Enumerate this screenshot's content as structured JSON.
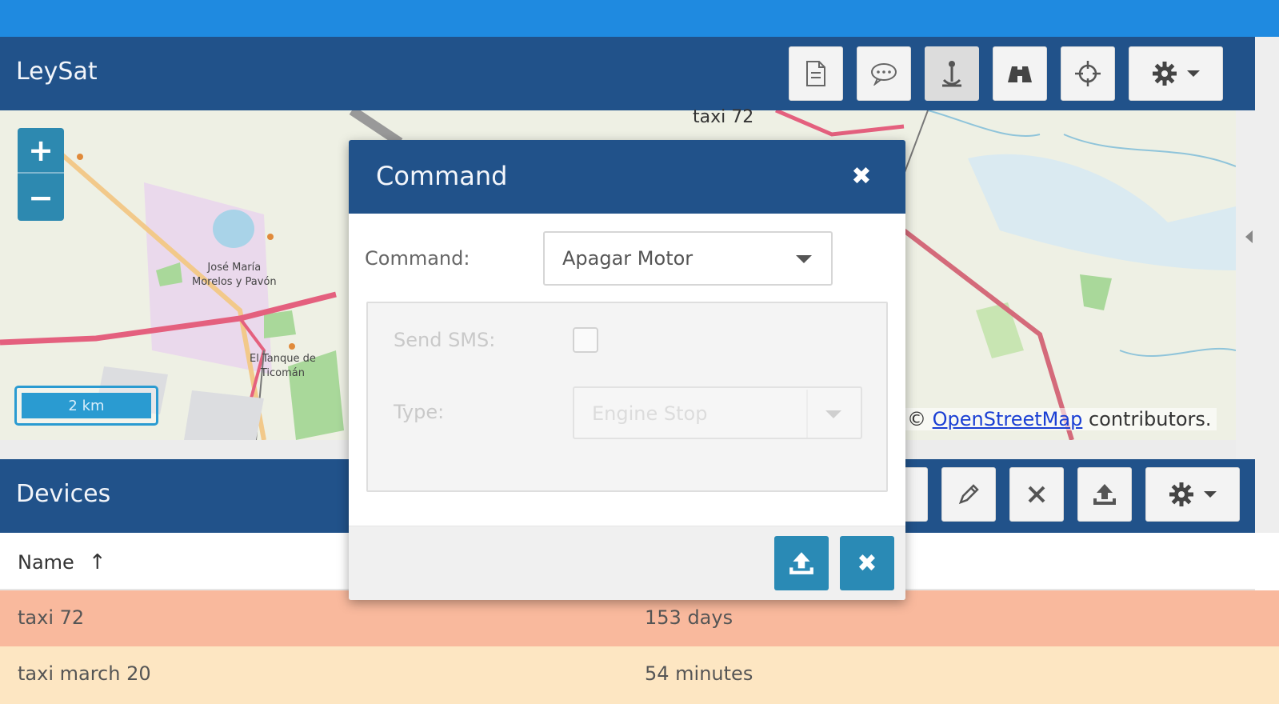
{
  "app": {
    "title": "LeySat"
  },
  "map_toolbar": {
    "buttons": [
      {
        "name": "report-button",
        "icon": "file-icon"
      },
      {
        "name": "command-button",
        "icon": "chat-bubble-icon"
      },
      {
        "name": "geofence-button",
        "icon": "anchor-pin-icon",
        "pressed": true
      },
      {
        "name": "binoculars-button",
        "icon": "binoculars-icon"
      },
      {
        "name": "follow-button",
        "icon": "crosshair-icon"
      },
      {
        "name": "settings-button",
        "icon": "gear-icon"
      }
    ]
  },
  "map": {
    "zoom_in": "+",
    "zoom_out": "−",
    "scale_label": "2 km",
    "device_label": "taxi 72",
    "place_labels": [
      "José María\nMorelos y Pavón",
      "El Tanque de\nTicomán"
    ],
    "attribution_prefix": "©",
    "attribution_link": "OpenStreetMap",
    "attribution_suffix": "contributors."
  },
  "devices_panel": {
    "title": "Devices",
    "toolbar_icons": [
      "pencil-icon",
      "close-icon",
      "upload-icon",
      "gear-icon"
    ],
    "columns": {
      "name": "Name",
      "sort_indicator": "↑"
    },
    "rows": [
      {
        "name": "taxi 72",
        "last_update": "153 days",
        "color": "#f9b99d"
      },
      {
        "name": "taxi march 20",
        "last_update": "54 minutes",
        "color": "#fde6c2"
      }
    ]
  },
  "dialog": {
    "title": "Command",
    "close_symbol": "✖",
    "command_label": "Command:",
    "command_value": "Apagar Motor",
    "send_sms_label": "Send SMS:",
    "type_label": "Type:",
    "type_value": "Engine Stop",
    "send_icon": "upload-icon",
    "cancel_symbol": "✖"
  },
  "colors": {
    "primary": "#21528a",
    "top_bar": "#1f8ae0",
    "accent": "#2a8ab5"
  }
}
